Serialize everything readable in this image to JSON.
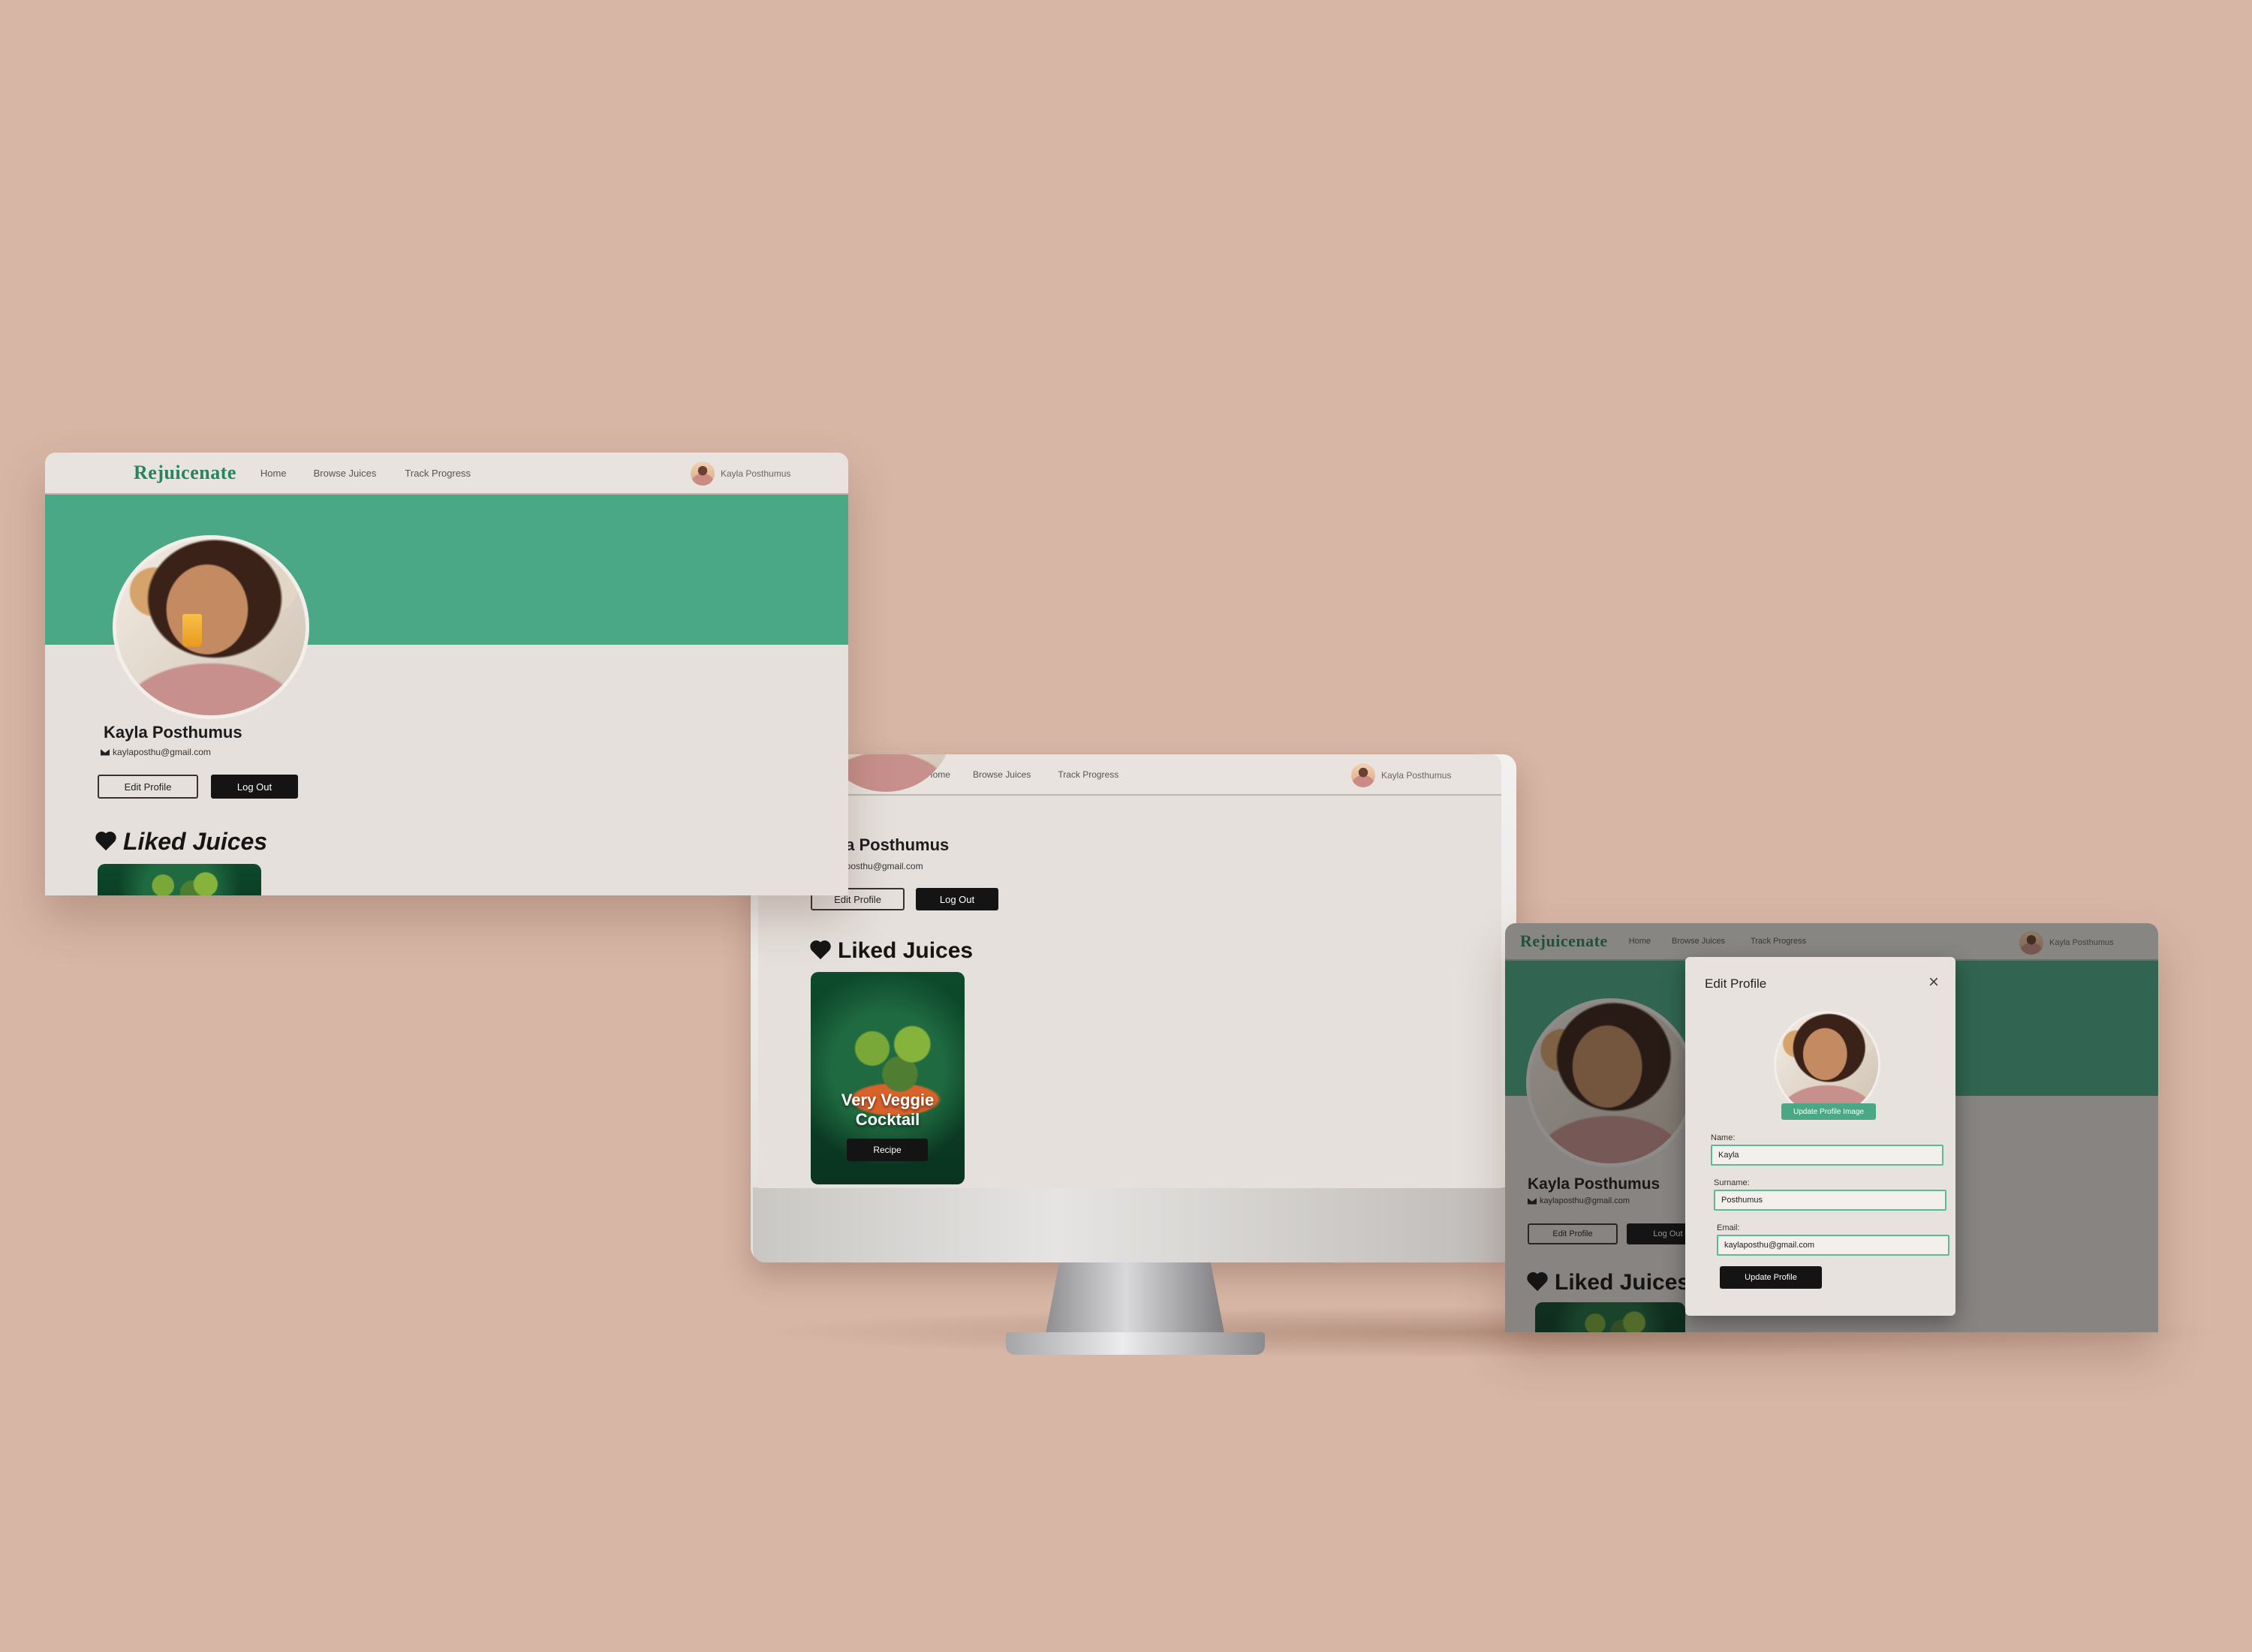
{
  "app": {
    "logo": "Rejuicenate",
    "logo_partial": "juicenate",
    "nav": [
      "Home",
      "Browse Juices",
      "Track Progress"
    ],
    "user_name": "Kayla Posthumus"
  },
  "profile": {
    "name": "Kayla Posthumus",
    "name_partial": "la Posthumus",
    "email": "kaylaposthu@gmail.com",
    "email_partial": "aposthu@gmail.com",
    "edit_label": "Edit Profile",
    "logout_label": "Log Out",
    "liked_heading": "Liked Juices"
  },
  "juice_cards": [
    {
      "title_line1": "Very Veggie",
      "title_line2": "Cocktail",
      "button": "Recipe"
    }
  ],
  "edit_modal": {
    "title": "Edit Profile",
    "close": "×",
    "update_image_label": "Update Profile Image",
    "fields": [
      {
        "label": "Name:",
        "value": "Kayla"
      },
      {
        "label": "Surname:",
        "value": "Posthumus"
      },
      {
        "label": "Email:",
        "value": "kaylaposthu@gmail.com"
      }
    ],
    "submit_label": "Update Profile"
  },
  "colors": {
    "background": "#d7b6a6",
    "brand_green": "#27855c",
    "banner_green": "#4aa886",
    "dark_button": "#141414"
  }
}
